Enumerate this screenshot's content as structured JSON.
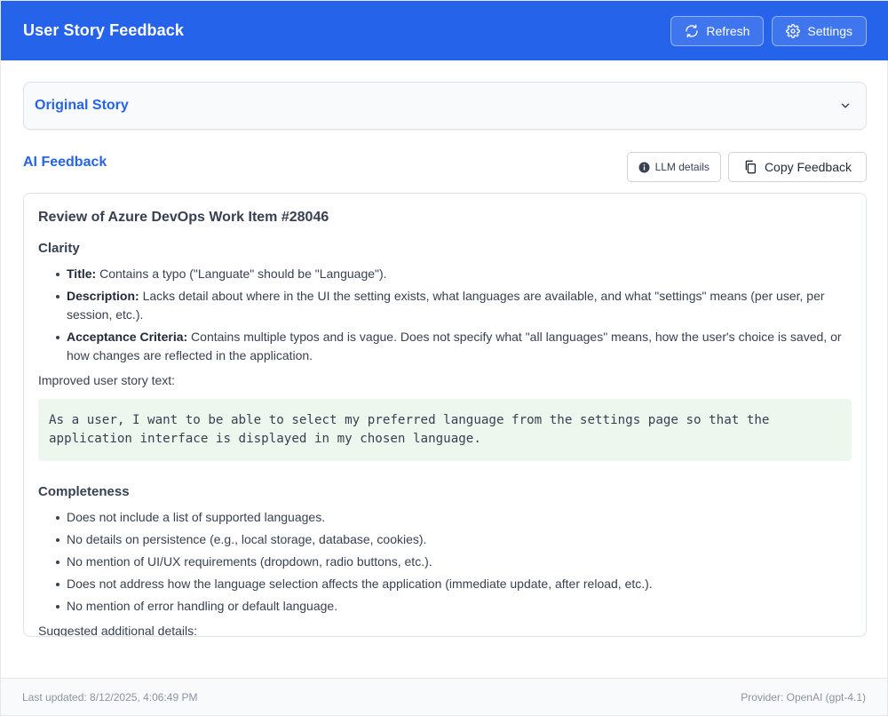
{
  "header": {
    "title": "User Story Feedback",
    "refresh_label": "Refresh",
    "settings_label": "Settings"
  },
  "original_story": {
    "title": "Original Story"
  },
  "feedback": {
    "title": "AI Feedback",
    "llm_details_label": "LLM details",
    "copy_label": "Copy Feedback",
    "heading": "Review of Azure DevOps Work Item #28046",
    "clarity": {
      "heading": "Clarity",
      "items": [
        {
          "label": "Title:",
          "text": " Contains a typo (\"Languate\" should be \"Language\")."
        },
        {
          "label": "Description:",
          "text": " Lacks detail about where in the UI the setting exists, what languages are available, and what \"settings\" means (per user, per session, etc.)."
        },
        {
          "label": "Acceptance Criteria:",
          "text": " Contains multiple typos and is vague. Does not specify what \"all languages\" means, how the user's choice is saved, or how changes are reflected in the application."
        }
      ],
      "improved_label": "Improved user story text:",
      "improved_text": "As a user, I want to be able to select my preferred language from the settings page so that the application interface is displayed in my chosen language."
    },
    "completeness": {
      "heading": "Completeness",
      "items": [
        "Does not include a list of supported languages.",
        "No details on persistence (e.g., local storage, database, cookies).",
        "No mention of UI/UX requirements (dropdown, radio buttons, etc.).",
        "Does not address how the language selection affects the application (immediate update, after reload, etc.).",
        "No mention of error handling or default language."
      ],
      "suggested_label": "Suggested additional details:"
    }
  },
  "footer": {
    "last_updated": "Last updated: 8/12/2025, 4:06:49 PM",
    "provider": "Provider: OpenAI (gpt-4.1)"
  },
  "colors": {
    "accent": "#2563eb",
    "code_bg": "#edf7ee"
  },
  "icons": {
    "refresh": "refresh-icon",
    "settings": "gear-icon",
    "chevron": "chevron-down-icon",
    "info": "info-icon",
    "copy": "copy-icon"
  }
}
